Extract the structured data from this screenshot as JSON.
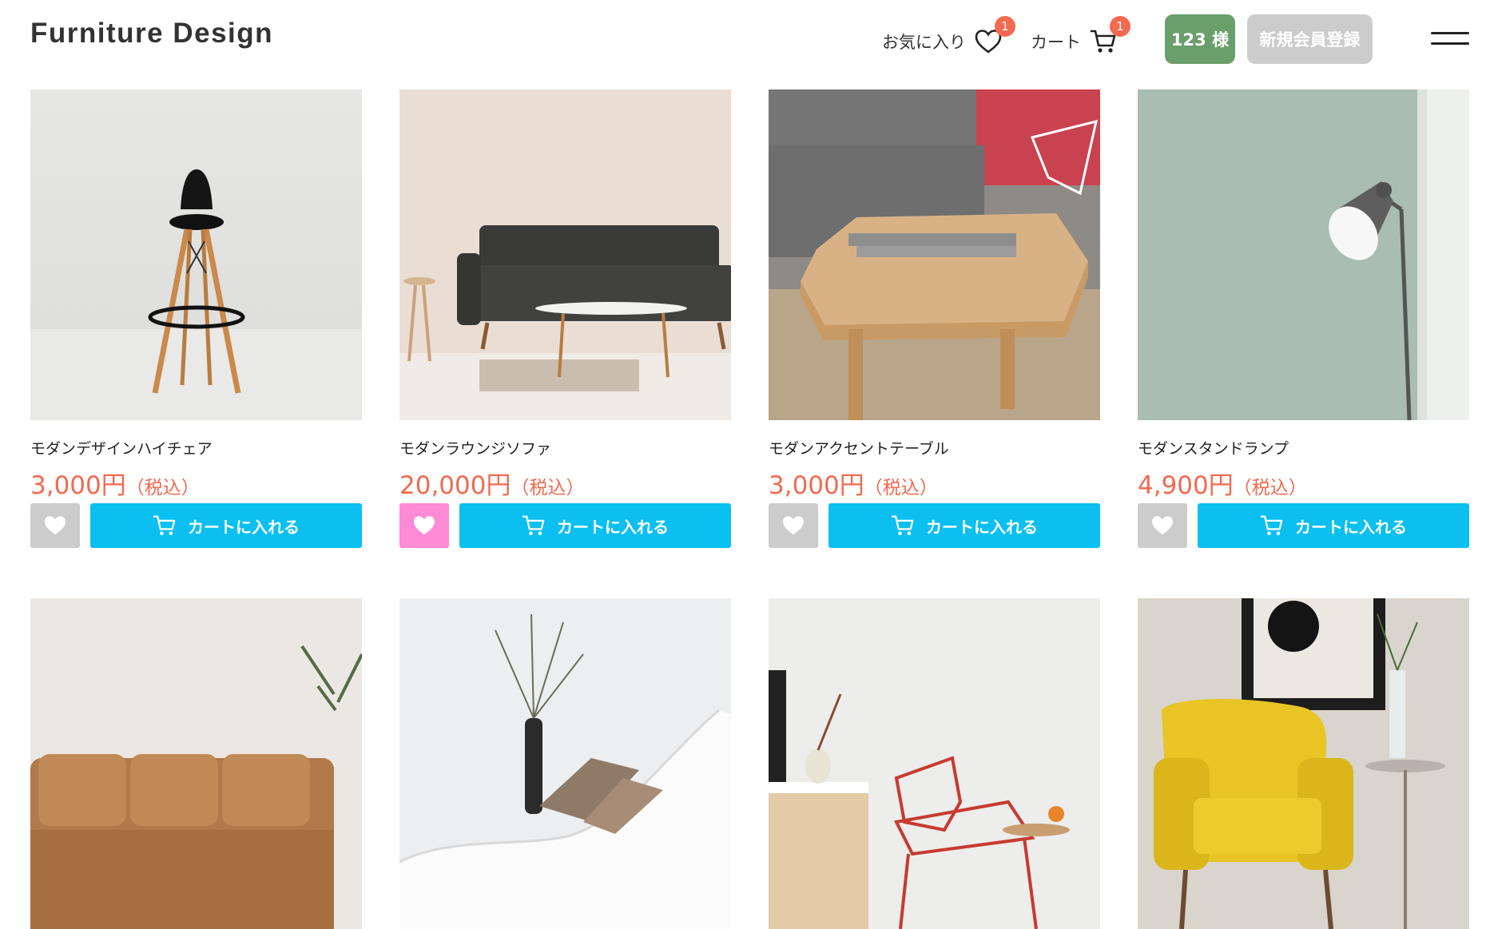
{
  "header": {
    "logo": "Furniture Design",
    "favorites_label": "お気に入り",
    "favorites_count": "1",
    "cart_label": "カート",
    "cart_count": "1",
    "user_label": "123 様",
    "register_label": "新規会員登録"
  },
  "colors": {
    "accent_price": "#f26a4f",
    "cart_button": "#0bc0f0",
    "favorite_active": "#ff8ad6",
    "user_pill": "#6a9e6a"
  },
  "products": [
    {
      "name": "モダンデザインハイチェア",
      "price": "3,000円",
      "tax": "（税込）",
      "favorite": false,
      "cart_label": "カートに入れる"
    },
    {
      "name": "モダンラウンジソファ",
      "price": "20,000円",
      "tax": "（税込）",
      "favorite": true,
      "cart_label": "カートに入れる"
    },
    {
      "name": "モダンアクセントテーブル",
      "price": "3,000円",
      "tax": "（税込）",
      "favorite": false,
      "cart_label": "カートに入れる"
    },
    {
      "name": "モダンスタンドランプ",
      "price": "4,900円",
      "tax": "（税込）",
      "favorite": false,
      "cart_label": "カートに入れる"
    }
  ]
}
